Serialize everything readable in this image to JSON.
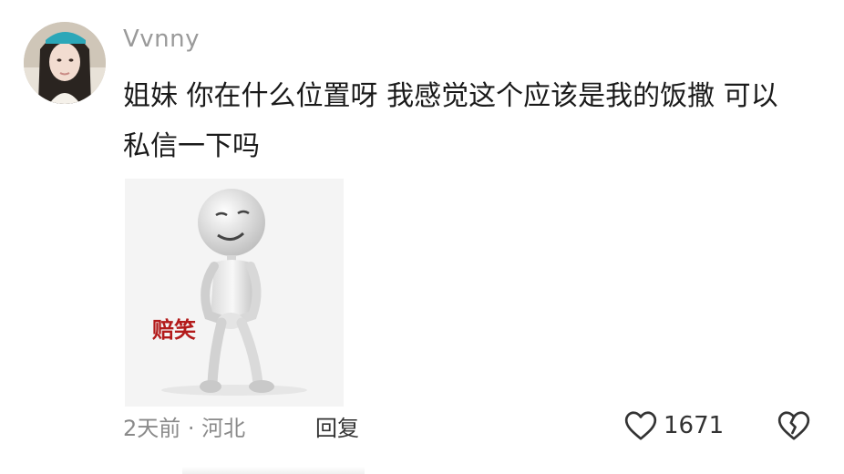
{
  "comment": {
    "username": "Vvnny",
    "text": "姐妹 你在什么位置呀 我感觉这个应该是我的饭撒 可以私信一下吗",
    "sticker": {
      "caption": "赔笑"
    },
    "meta": {
      "time_location": "2天前 · 河北",
      "reply_label": "回复"
    },
    "likes": "1671",
    "icons": {
      "like": "heart-outline-icon",
      "dislike": "broken-heart-icon"
    }
  }
}
